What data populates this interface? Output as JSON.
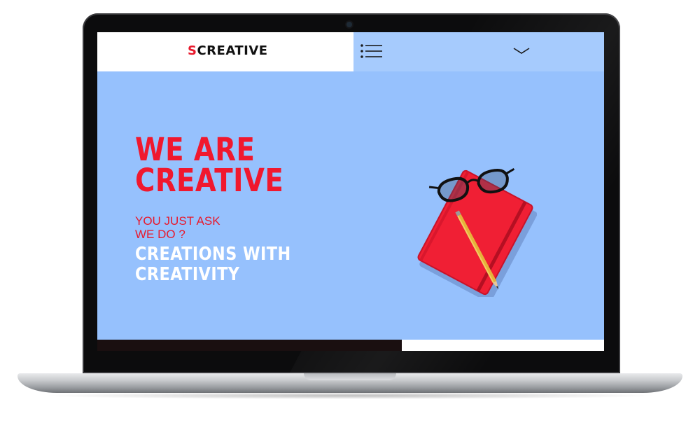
{
  "header": {
    "logo_initial": "S",
    "logo_rest": "CREATIVE",
    "menu_icon": "hamburger-list-icon",
    "dropdown_icon": "chevron-down-icon"
  },
  "hero": {
    "headline_line1": "WE ARE",
    "headline_line2": "CREATIVE",
    "tagline_line1": "YOU JUST ASK",
    "tagline_line2": "WE DO ?",
    "subline_line1": "CREATIONS WITH",
    "subline_line2": "CREATIVITY",
    "illustration": "red-notebook-glasses-pencil"
  },
  "colors": {
    "accent_red": "#f0182e",
    "hero_background": "#96c1fd",
    "header_right_background": "#a6cbfd",
    "header_left_background": "#ffffff",
    "bottom_bar_dark": "#1a0f10"
  }
}
